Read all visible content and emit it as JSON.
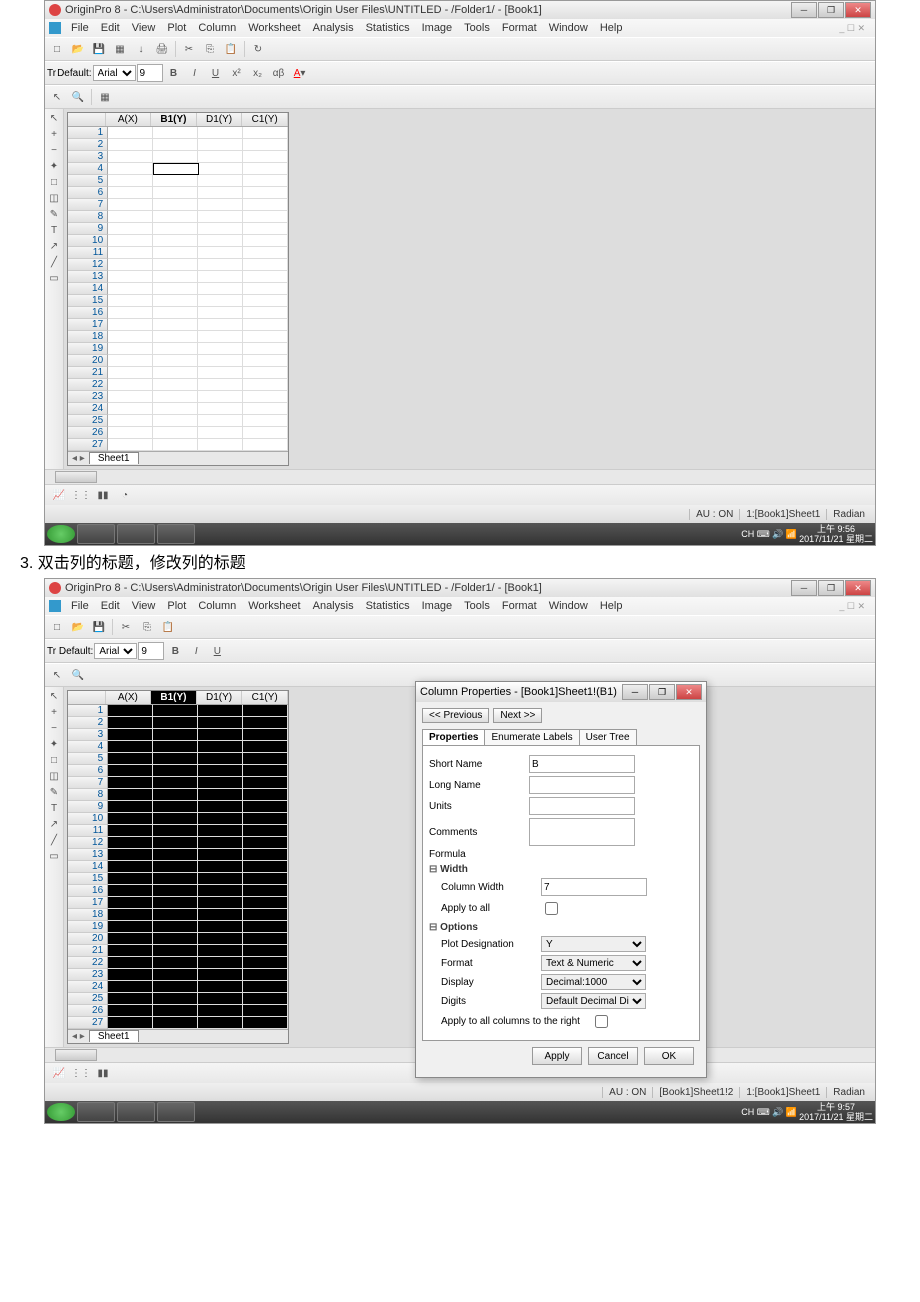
{
  "step": {
    "num": "3.",
    "text": "双击列的标题，修改列的标题"
  },
  "s1": {
    "title": "OriginPro 8 - C:\\Users\\Administrator\\Documents\\Origin User Files\\UNTITLED - /Folder1/ - [Book1]",
    "menu": [
      "File",
      "Edit",
      "View",
      "Plot",
      "Column",
      "Worksheet",
      "Analysis",
      "Statistics",
      "Image",
      "Tools",
      "Format",
      "Window",
      "Help"
    ],
    "font_label": "Default:",
    "font_name": "Tr",
    "font_size": "9",
    "cols": [
      "A(X)",
      "B1(Y)",
      "D1(Y)",
      "C1(Y)"
    ],
    "sheet": "Sheet1",
    "status": {
      "au": "AU : ON",
      "sel": "1:[Book1]Sheet1",
      "mode": "Radian"
    },
    "clock": {
      "t": "上午 9:56",
      "d": "2017/11/21 星期二"
    }
  },
  "s2": {
    "title": "OriginPro 8 - C:\\Users\\Administrator\\Documents\\Origin User Files\\UNTITLED - /Folder1/ - [Book1]",
    "menu": [
      "File",
      "Edit",
      "View",
      "Plot",
      "Column",
      "Worksheet",
      "Analysis",
      "Statistics",
      "Image",
      "Tools",
      "Format",
      "Window",
      "Help"
    ],
    "cols": [
      "A(X)",
      "B1(Y)",
      "D1(Y)",
      "C1(Y)"
    ],
    "sheet": "Sheet1",
    "dialog": {
      "title": "Column Properties - [Book1]Sheet1!(B1)",
      "prev": "<< Previous",
      "next": "Next >>",
      "tabs": [
        "Properties",
        "Enumerate Labels",
        "User Tree"
      ],
      "fields": {
        "short": "Short Name",
        "short_val": "B",
        "long": "Long Name",
        "units": "Units",
        "comments": "Comments",
        "formula": "Formula",
        "width_sec": "Width",
        "colwidth": "Column Width",
        "colwidth_val": "7",
        "apply_all": "Apply to all",
        "opt_sec": "Options",
        "plotdes": "Plot Designation",
        "plotdes_val": "Y",
        "format": "Format",
        "format_val": "Text & Numeric",
        "display": "Display",
        "display_val": "Decimal:1000",
        "digits": "Digits",
        "digits_val": "Default Decimal Digits",
        "apply_right": "Apply to all columns to the right"
      },
      "btns": {
        "apply": "Apply",
        "cancel": "Cancel",
        "ok": "OK"
      }
    },
    "status": {
      "au": "AU : ON",
      "sel1": "[Book1]Sheet1!2",
      "sel2": "1:[Book1]Sheet1",
      "mode": "Radian"
    },
    "clock": {
      "t": "上午 9:57",
      "d": "2017/11/21 星期二"
    }
  }
}
